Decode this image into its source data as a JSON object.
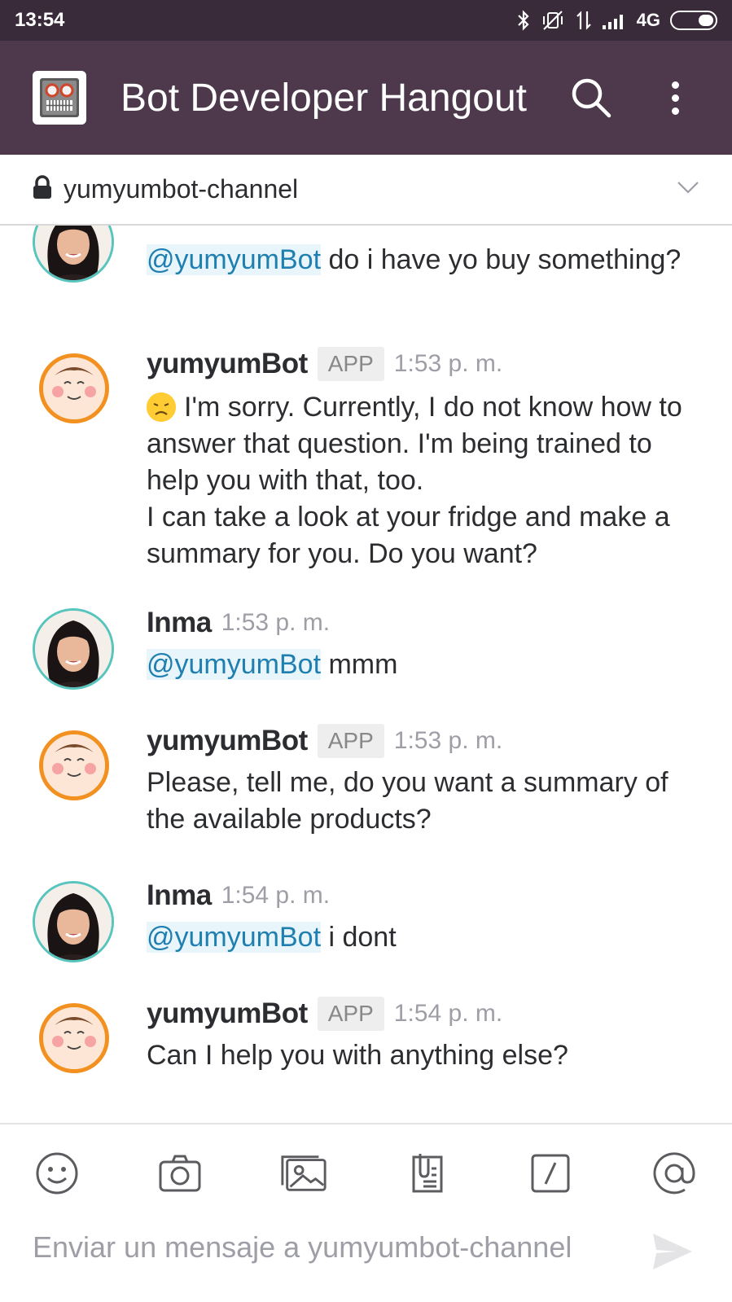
{
  "status_bar": {
    "time": "13:54",
    "network": "4G"
  },
  "header": {
    "workspace_title": "Bot Developer Hangout"
  },
  "channel": {
    "name": "yumyumbot-channel"
  },
  "messages": [
    {
      "mention": "@yumyumBot",
      "text": " do i have yo buy something?"
    },
    {
      "author": "yumyumBot",
      "badge": "APP",
      "time": "1:53 p. m.",
      "text": "I'm sorry. Currently, I do not know how to answer that question. I'm being trained to help you with that, too.",
      "text2": "I can take a look at your fridge and make a summary for you. Do you want?"
    },
    {
      "author": "Inma",
      "time": "1:53 p. m.",
      "mention": "@yumyumBot",
      "text": " mmm"
    },
    {
      "author": "yumyumBot",
      "badge": "APP",
      "time": "1:53 p. m.",
      "text": "Please, tell me, do you want a summary of the available products?"
    },
    {
      "author": "Inma",
      "time": "1:54 p. m.",
      "mention": "@yumyumBot",
      "text": " i dont"
    },
    {
      "author": "yumyumBot",
      "badge": "APP",
      "time": "1:54 p. m.",
      "text": "Can I help you with anything else?"
    }
  ],
  "composer": {
    "placeholder": "Enviar un mensaje a yumyumbot-channel"
  }
}
